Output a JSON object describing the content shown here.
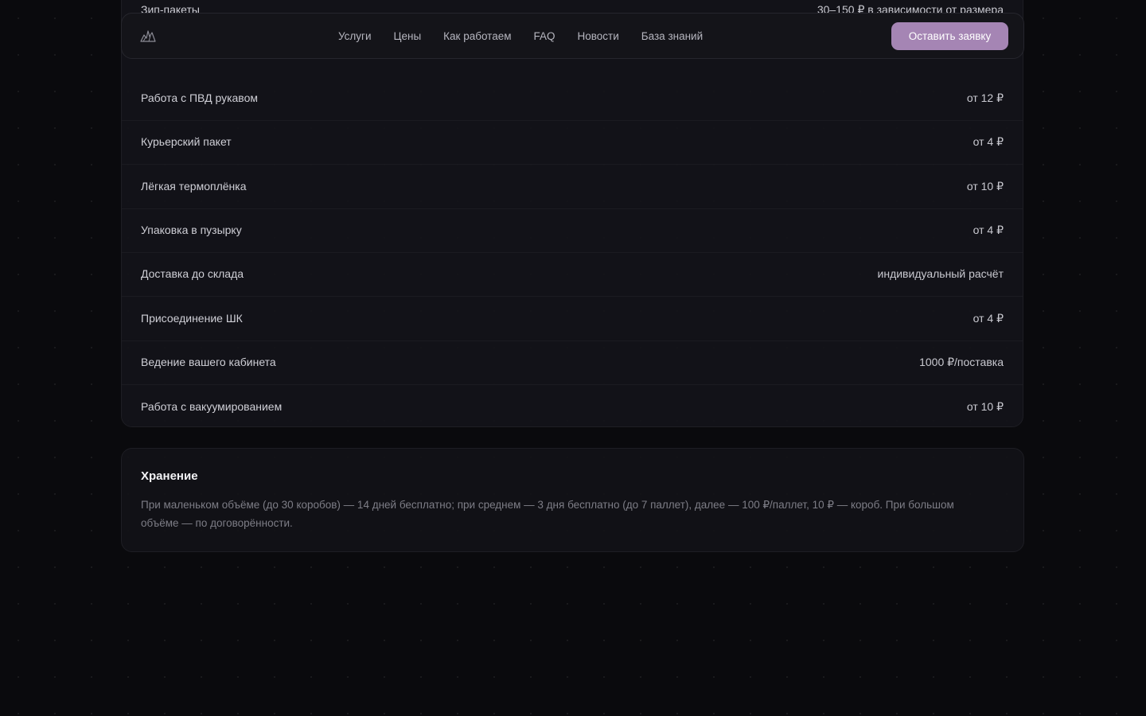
{
  "price_list": {
    "rows": [
      {
        "name": "Зип-пакеты",
        "price": "30–150 ₽ в зависимости от размера"
      },
      {
        "name": "Работа с ПВД рукавом",
        "price": "от 12 ₽"
      },
      {
        "name": "Курьерский пакет",
        "price": "от 4 ₽"
      },
      {
        "name": "Лёгкая термоплёнка",
        "price": "от 10 ₽"
      },
      {
        "name": "Упаковка в пузырку",
        "price": "от 4 ₽"
      },
      {
        "name": "Доставка до склада",
        "price": "индивидуальный расчёт"
      },
      {
        "name": "Присоединение ШК",
        "price": "от 4 ₽"
      },
      {
        "name": "Ведение вашего кабинета",
        "price": "1000 ₽/поставка"
      },
      {
        "name": "Работа с вакуумированием",
        "price": "от 10 ₽"
      }
    ]
  },
  "navbar": {
    "logo_icon": "rabbit-logo-icon",
    "links": [
      "Услуги",
      "Цены",
      "Как работаем",
      "FAQ",
      "Новости",
      "База знаний"
    ],
    "cta_label": "Оставить заявку"
  },
  "storage": {
    "title": "Хранение",
    "text": "При маленьком объёме (до 30 коробов) — 14 дней бесплатно; при среднем — 3 дня бесплатно (до 7 паллет), далее — 100 ₽/паллет, 10 ₽ — короб. При большом объёме — по договорённости."
  },
  "colors": {
    "background": "#0a0a0d",
    "card": "#141419",
    "accent": "#a585b4"
  }
}
